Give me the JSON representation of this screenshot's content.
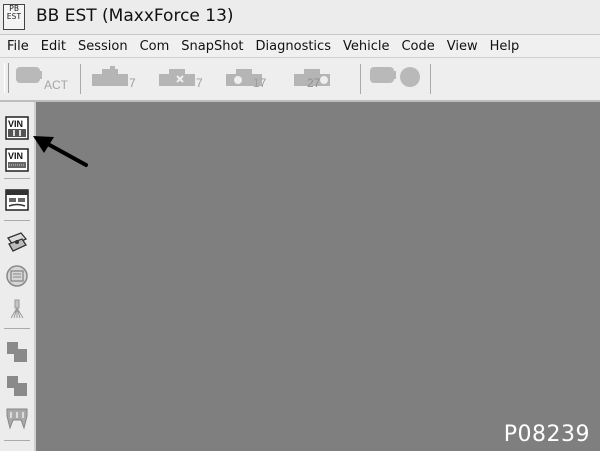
{
  "window": {
    "icon_text": "PB EST",
    "title": "BB EST (MaxxForce 13)"
  },
  "menu": {
    "items": [
      {
        "label": "File"
      },
      {
        "label": "Edit"
      },
      {
        "label": "Session"
      },
      {
        "label": "Com"
      },
      {
        "label": "SnapShot"
      },
      {
        "label": "Diagnostics"
      },
      {
        "label": "Vehicle"
      },
      {
        "label": "Code"
      },
      {
        "label": "View"
      },
      {
        "label": "Help"
      }
    ]
  },
  "toolbar": {
    "buttons": [
      {
        "icon": "act-connector-icon",
        "label": "ACT"
      },
      {
        "icon": "engine-test-icon",
        "label": "7"
      },
      {
        "icon": "engine-test-icon",
        "label": "7"
      },
      {
        "icon": "engine-test-icon",
        "label": "17"
      },
      {
        "icon": "engine-test-icon",
        "label": "27"
      },
      {
        "icon": "module-indicator-icon",
        "label": ""
      }
    ]
  },
  "sidebar": {
    "buttons": [
      {
        "icon": "vin-icon",
        "label": "VIN"
      },
      {
        "icon": "vin-icon",
        "label": "VIN"
      },
      {
        "icon": "parameter-screen-icon",
        "label": ""
      },
      {
        "icon": "connector-icon",
        "label": ""
      },
      {
        "icon": "engine-diagram-icon",
        "label": ""
      },
      {
        "icon": "spray-icon",
        "label": ""
      },
      {
        "icon": "module-block-icon",
        "label": ""
      },
      {
        "icon": "module-block-icon",
        "label": ""
      },
      {
        "icon": "tooth-icon",
        "label": ""
      }
    ]
  },
  "figure_label": "P08239"
}
